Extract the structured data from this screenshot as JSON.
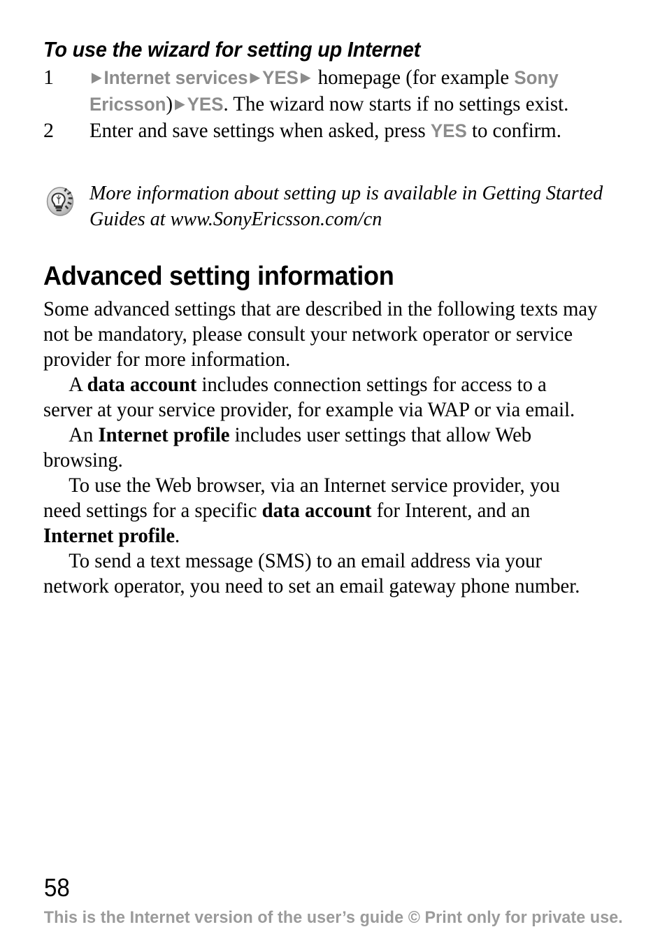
{
  "document": {
    "page_number": "58",
    "footer_note": "This is the Internet version of the user’s guide © Print only for private use."
  },
  "task": {
    "heading": "To use the wizard for setting up Internet",
    "steps": [
      {
        "number": "1",
        "parts": [
          {
            "type": "arrow",
            "text": "▶"
          },
          {
            "type": "menu",
            "text": "Internet services"
          },
          {
            "type": "arrow",
            "text": "▶"
          },
          {
            "type": "menu",
            "text": "YES"
          },
          {
            "type": "arrow",
            "text": "▶"
          },
          {
            "type": "plain",
            "text": " homepage (for example "
          },
          {
            "type": "menu",
            "text": "Sony Ericsson"
          },
          {
            "type": "plain",
            "text": ")"
          },
          {
            "type": "arrow",
            "text": "▶"
          },
          {
            "type": "menu",
            "text": "YES"
          },
          {
            "type": "plain",
            "text": ". The wizard now starts if no settings exist."
          }
        ]
      },
      {
        "number": "2",
        "parts": [
          {
            "type": "plain",
            "text": "Enter and save settings when asked, press "
          },
          {
            "type": "menu",
            "text": "YES"
          },
          {
            "type": "plain",
            "text": " to confirm."
          }
        ]
      }
    ]
  },
  "note": {
    "icon": "lightbulb-tip-icon",
    "text": "More information about setting up is available in Getting Started Guides at www.SonyEricsson.com/cn"
  },
  "section": {
    "heading": "Advanced setting information",
    "paragraphs": [
      {
        "indent": false,
        "runs": [
          {
            "bold": false,
            "text": "Some advanced settings that are described in the following texts may not be mandatory, please consult your network operator or service provider for more information."
          }
        ]
      },
      {
        "indent": true,
        "runs": [
          {
            "bold": false,
            "text": "A "
          },
          {
            "bold": true,
            "text": "data account"
          },
          {
            "bold": false,
            "text": " includes connection settings for access to a server at your service provider, for example via WAP or via email."
          }
        ]
      },
      {
        "indent": true,
        "runs": [
          {
            "bold": false,
            "text": "An "
          },
          {
            "bold": true,
            "text": "Internet profile"
          },
          {
            "bold": false,
            "text": " includes user settings that allow Web browsing."
          }
        ]
      },
      {
        "indent": true,
        "runs": [
          {
            "bold": false,
            "text": "To use the Web browser, via an Internet service provider, you need settings for a specific "
          },
          {
            "bold": true,
            "text": "data account"
          },
          {
            "bold": false,
            "text": " for Interent, and an "
          },
          {
            "bold": true,
            "text": "Internet profile"
          },
          {
            "bold": false,
            "text": "."
          }
        ]
      },
      {
        "indent": true,
        "runs": [
          {
            "bold": false,
            "text": "To send a text message (SMS) to an email address via your network operator, you need to set an email gateway phone number."
          }
        ]
      }
    ]
  },
  "colors": {
    "menu_gray": "#8c8c8c",
    "footer_gray": "#9b9b9b",
    "text_black": "#000000",
    "page_background": "#ffffff"
  }
}
